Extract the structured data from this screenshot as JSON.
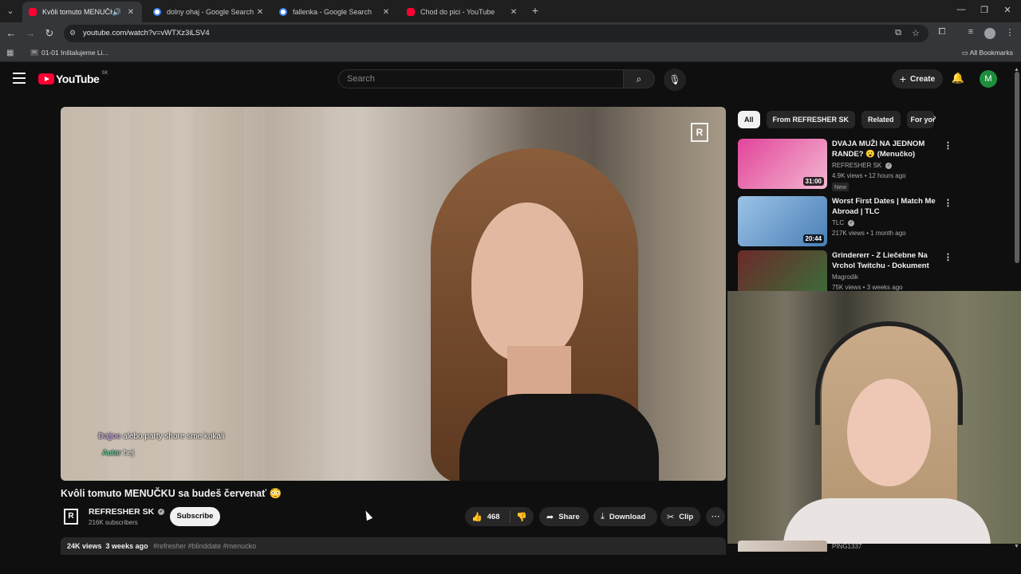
{
  "browser": {
    "tabs": [
      {
        "title": "Kvôli tomuto MENUČKU sa",
        "type": "yt",
        "active": true
      },
      {
        "title": "dolny ohaj - Google Search",
        "type": "g",
        "active": false
      },
      {
        "title": "fallenka - Google Search",
        "type": "g",
        "active": false
      },
      {
        "title": "Chod do pici - YouTube",
        "type": "yt",
        "active": false
      }
    ],
    "url": "youtube.com/watch?v=vWTXz3iLSV4",
    "bookmark": "01-01 Inštalujeme Li...",
    "all_bookmarks": "All Bookmarks"
  },
  "youtube": {
    "logo_text": "YouTube",
    "country": "SK",
    "search_placeholder": "Search",
    "create_label": "Create",
    "user_initial": "M"
  },
  "video": {
    "title": "Kvôli tomuto MENUČKU sa budeš červenať 😳",
    "channel": "REFRESHER SK",
    "channel_logo": "R",
    "subscribers": "216K subscribers",
    "subscribe_label": "Subscribe",
    "likes": "468",
    "share_label": "Share",
    "download_label": "Download",
    "clip_label": "Clip",
    "views": "24K views",
    "posted": "3 weeks ago",
    "tags": "#refresher #blinddate #menucko"
  },
  "chat": [
    {
      "user": "Dajjoo",
      "message": "alebo party shore sme kukali"
    },
    {
      "user": "Autar",
      "message": "hej"
    }
  ],
  "sidebar": {
    "chips": [
      "All",
      "From REFRESHER SK",
      "Related",
      "For you"
    ],
    "recommendations": [
      {
        "title": "DVAJA MUŽI NA JEDNOM RANDE? 😮 (Menučko)",
        "channel": "REFRESHER SK",
        "meta": "4.9K views • 12 hours ago",
        "badge": "New",
        "duration": "31:00",
        "thumb_colors": [
          "#e2449a",
          "#f3b7d1"
        ]
      },
      {
        "title": "Worst First Dates | Match Me Abroad | TLC",
        "channel": "TLC",
        "meta": "217K views • 1 month ago",
        "badge": "",
        "duration": "20:44",
        "thumb_colors": [
          "#9bc3e6",
          "#4a7fb6"
        ]
      },
      {
        "title": "Grindererr - Z Liečebne Na Vrchol Twitchu - Dokument",
        "channel": "Magrodik",
        "meta": "75K views • 3 weeks ago",
        "badge": "",
        "duration": "",
        "thumb_colors": [
          "#6b2a2a",
          "#3a6f3a"
        ]
      }
    ],
    "bottom_item_text": "PING1337"
  }
}
